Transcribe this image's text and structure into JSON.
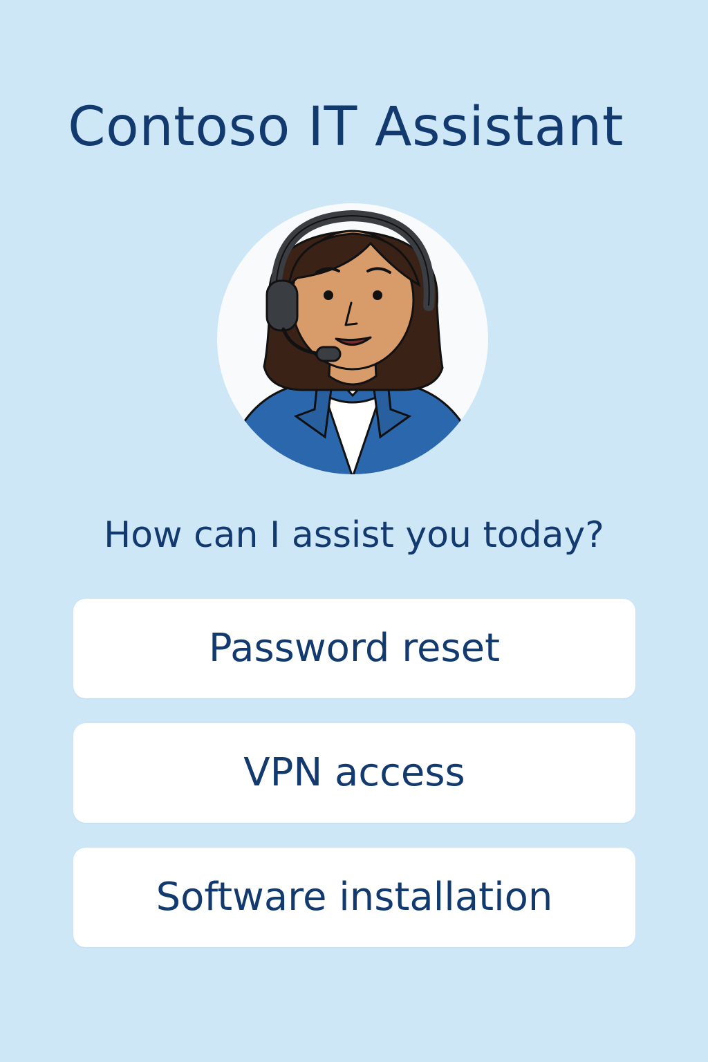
{
  "colors": {
    "background": "#cde7f7",
    "primary_text": "#123a6e",
    "card": "#ffffff",
    "avatar_circle": "#f8fafc",
    "jacket": "#2a67ad",
    "skin": "#d89b6a",
    "hair": "#3a2217",
    "headset": "#3a3d42"
  },
  "app": {
    "title": "Contoso IT Assistant"
  },
  "avatar": {
    "icon": "support-agent-icon"
  },
  "main": {
    "prompt": "How can I assist you today?",
    "options": [
      {
        "label": "Password reset"
      },
      {
        "label": "VPN access"
      },
      {
        "label": "Software installation"
      }
    ]
  }
}
